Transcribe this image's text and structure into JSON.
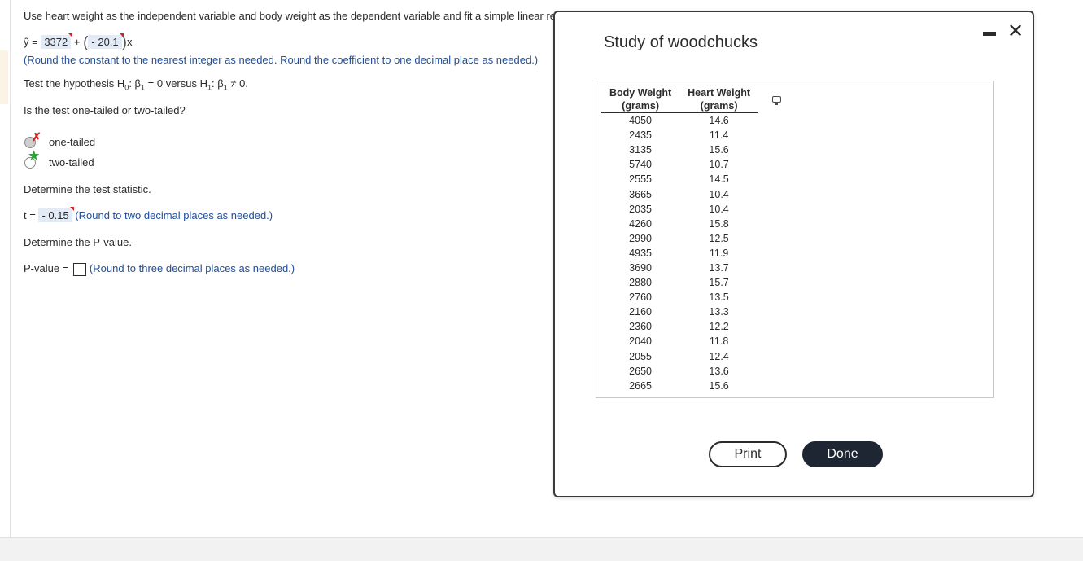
{
  "question": {
    "intro": "Use heart weight as the independent variable and body weight as the dependent variable and fit a simple linear re",
    "yhat": "ŷ",
    "equals": " = ",
    "constant": "3372",
    "plus": " + ",
    "coefficient": " - 20.1",
    "x_var": "x",
    "round_instruction": "(Round the constant to the nearest integer as needed. Round the coefficient to one decimal place as needed.)",
    "hypothesis_prefix": "Test the hypothesis H",
    "h0_sub": "0",
    "h0_text": ": β",
    "h0_beta_sub": "1",
    "h0_rest": " = 0 versus H",
    "h1_sub": "1",
    "h1_text": ": β",
    "h1_beta_sub": "1",
    "h1_rest": " ≠ 0.",
    "tail_question": "Is the test one-tailed or two-tailed?",
    "options": [
      {
        "label": "one-tailed",
        "selected": true,
        "mark": "✗"
      },
      {
        "label": "two-tailed",
        "selected": false,
        "mark": "★"
      }
    ],
    "test_stat_prompt": "Determine the test statistic.",
    "t_label": "t = ",
    "t_value": " - 0.15",
    "t_instruction": "(Round to two decimal places as needed.)",
    "pvalue_prompt": "Determine the P-value.",
    "pvalue_label": "P-value = ",
    "pvalue_value": "",
    "pvalue_instruction": "(Round to three decimal places as needed.)"
  },
  "dialog": {
    "title": "Study of woodchucks",
    "close_glyph": "✕",
    "table": {
      "headers": [
        {
          "line1": "Body Weight",
          "line2": "(grams)"
        },
        {
          "line1": "Heart Weight",
          "line2": "(grams)"
        }
      ],
      "rows": [
        [
          "4050",
          "14.6"
        ],
        [
          "2435",
          "11.4"
        ],
        [
          "3135",
          "15.6"
        ],
        [
          "5740",
          "10.7"
        ],
        [
          "2555",
          "14.5"
        ],
        [
          "3665",
          "10.4"
        ],
        [
          "2035",
          "10.4"
        ],
        [
          "4260",
          "15.8"
        ],
        [
          "2990",
          "12.5"
        ],
        [
          "4935",
          "11.9"
        ],
        [
          "3690",
          "13.7"
        ],
        [
          "2880",
          "15.7"
        ],
        [
          "2760",
          "13.5"
        ],
        [
          "2160",
          "13.3"
        ],
        [
          "2360",
          "12.2"
        ],
        [
          "2040",
          "11.8"
        ],
        [
          "2055",
          "12.4"
        ],
        [
          "2650",
          "13.6"
        ],
        [
          "2665",
          "15.6"
        ]
      ]
    },
    "print_label": "Print",
    "done_label": "Done"
  },
  "colors": {
    "instruction_blue": "#1f4e9c",
    "answer_box": "#e3ebf7",
    "error_red": "#d42020",
    "correct_green": "#1faa2e",
    "done_button": "#1f2633"
  }
}
